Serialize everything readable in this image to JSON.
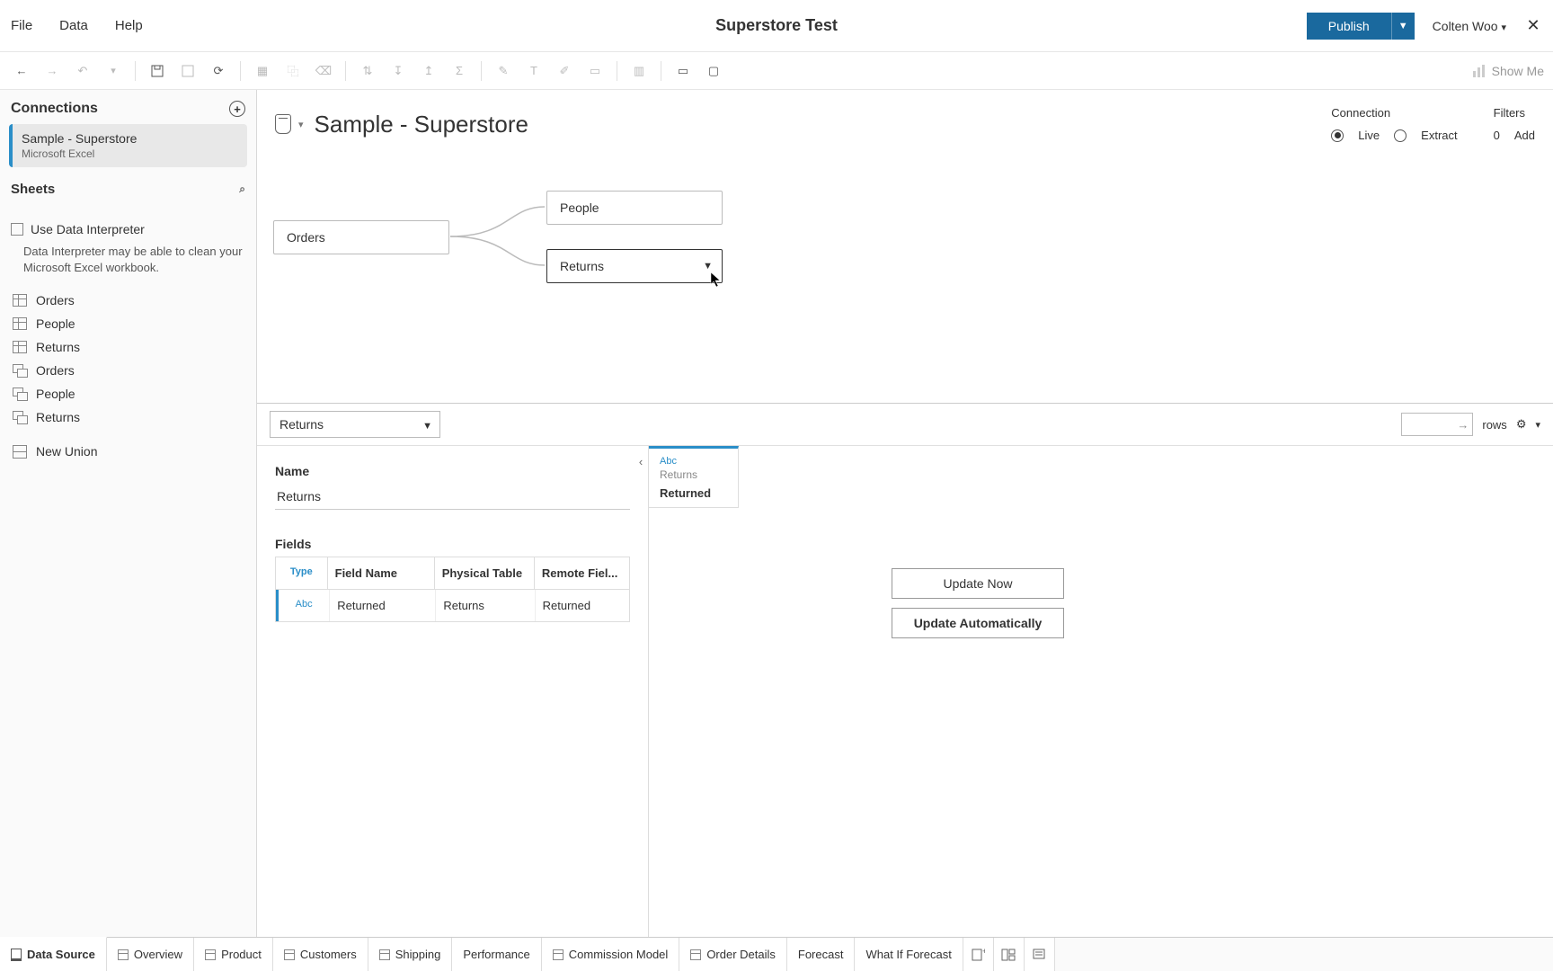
{
  "titlebar": {
    "menus": [
      "File",
      "Data",
      "Help"
    ],
    "title": "Superstore Test",
    "publish": "Publish",
    "user": "Colten Woo"
  },
  "toolbar": {
    "showme": "Show Me"
  },
  "sidebar": {
    "connections_label": "Connections",
    "connection": {
      "name": "Sample - Superstore",
      "source": "Microsoft Excel"
    },
    "sheets_label": "Sheets",
    "interpreter_label": "Use Data Interpreter",
    "interpreter_help": "Data Interpreter may be able to clean your Microsoft Excel workbook.",
    "sheets": [
      "Orders",
      "People",
      "Returns"
    ],
    "linked": [
      "Orders",
      "People",
      "Returns"
    ],
    "new_union": "New Union"
  },
  "datasource": {
    "title": "Sample - Superstore",
    "conn_label": "Connection",
    "live": "Live",
    "extract": "Extract",
    "filters_label": "Filters",
    "filters_count": "0",
    "filters_add": "Add"
  },
  "join": {
    "orders": "Orders",
    "people": "People",
    "returns": "Returns"
  },
  "bottom": {
    "selected_table": "Returns",
    "rows_label": "rows",
    "name_label": "Name",
    "name_value": "Returns",
    "fields_label": "Fields",
    "headers": {
      "type": "Type",
      "field_name": "Field Name",
      "physical_table": "Physical Table",
      "remote_field": "Remote Fiel..."
    },
    "row": {
      "type": "Abc",
      "field_name": "Returned",
      "physical_table": "Returns",
      "remote_field": "Returned"
    },
    "preview": {
      "type": "Abc",
      "table": "Returns",
      "field": "Returned"
    },
    "update_now": "Update Now",
    "update_auto": "Update Automatically"
  },
  "tabs": {
    "data_source": "Data Source",
    "list": [
      "Overview",
      "Product",
      "Customers",
      "Shipping",
      "Performance",
      "Commission Model",
      "Order Details",
      "Forecast",
      "What If Forecast"
    ]
  }
}
